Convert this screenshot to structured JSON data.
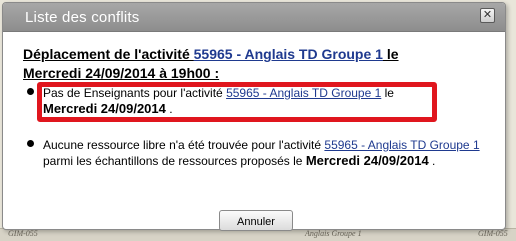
{
  "dialog": {
    "title": "Liste des conflits",
    "close_symbol": "✕"
  },
  "conflict": {
    "headline_prefix": "Déplacement de l'activité ",
    "headline_link": "55965 - Anglais TD Groupe 1",
    "headline_suffix": " le",
    "headline_date": "Mercredi 24/09/2014 à 19h00 :",
    "items": [
      {
        "text_before": "Pas de Enseignants pour l'activité ",
        "link": "55965 - Anglais TD Groupe 1",
        "text_after": " le",
        "date": "Mercredi 24/09/2014",
        "end": " ."
      },
      {
        "text_before": "Aucune ressource libre n'a été trouvée pour l'activité ",
        "link": "55965 - Anglais TD Groupe 1",
        "text_after": " parmi les échantillons de ressources proposés le ",
        "date": "Mercredi 24/09/2014",
        "end": " ."
      }
    ]
  },
  "buttons": {
    "cancel_label": "Annuler"
  },
  "background": {
    "left_text": "GIM-055",
    "mid_text": "Anglais Groupe 1",
    "right_text": "GIM-055"
  },
  "colors": {
    "highlight": "#e0161e",
    "link": "#1f3a8f",
    "titlebar": "#9a9a9a"
  }
}
